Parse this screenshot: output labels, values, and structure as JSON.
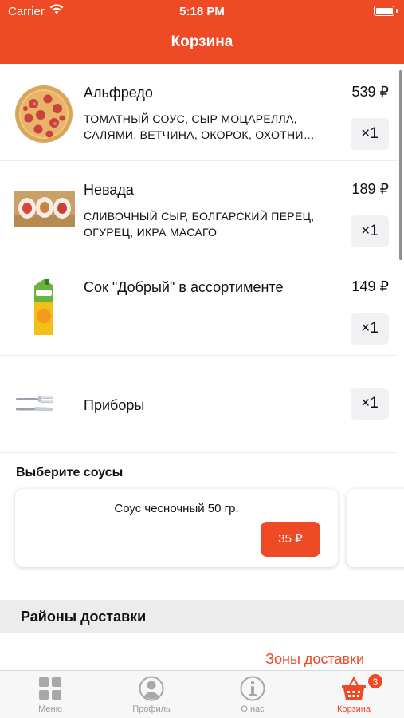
{
  "status_bar": {
    "carrier": "Carrier",
    "time": "5:18 PM"
  },
  "nav": {
    "title": "Корзина"
  },
  "cart": {
    "items": [
      {
        "name": "Альфредо",
        "description": "ТОМАТНЫЙ СОУС, СЫР МОЦАРЕЛЛА, САЛЯМИ, ВЕТЧИНА, ОКОРОК, ОХОТНИ…",
        "price": "539 ₽",
        "quantity": "×1",
        "image": "pizza-image"
      },
      {
        "name": "Невада",
        "description": "СЛИВОЧНЫЙ СЫР, БОЛГАРСКИЙ ПЕРЕЦ, ОГУРЕЦ, ИКРА МАСАГО",
        "price": "189 ₽",
        "quantity": "×1",
        "image": "sushi-roll-image"
      },
      {
        "name": "Сок \"Добрый\" в ассортименте",
        "description": "",
        "price": "149 ₽",
        "quantity": "×1",
        "image": "juice-box-image"
      },
      {
        "name": "Приборы",
        "description": "",
        "price": "",
        "quantity": "×1",
        "image": "cutlery-image"
      }
    ]
  },
  "sauces": {
    "title": "Выберите соусы",
    "items": [
      {
        "name": "Соус чесночный 50 гр.",
        "price": "35 ₽"
      }
    ]
  },
  "delivery": {
    "header": "Районы доставки",
    "zones_link": "Зоны доставки"
  },
  "tab_bar": {
    "tabs": [
      {
        "label": "Меню",
        "icon": "grid-icon"
      },
      {
        "label": "Профиль",
        "icon": "profile-icon"
      },
      {
        "label": "О нас",
        "icon": "info-icon"
      },
      {
        "label": "Корзина",
        "icon": "basket-icon",
        "badge": "3",
        "active": true
      }
    ]
  },
  "colors": {
    "accent": "#ee4a25",
    "inactive_tab": "#9a9a9a",
    "qty_bg": "#f1f1f3",
    "section_bg": "#ececec"
  }
}
